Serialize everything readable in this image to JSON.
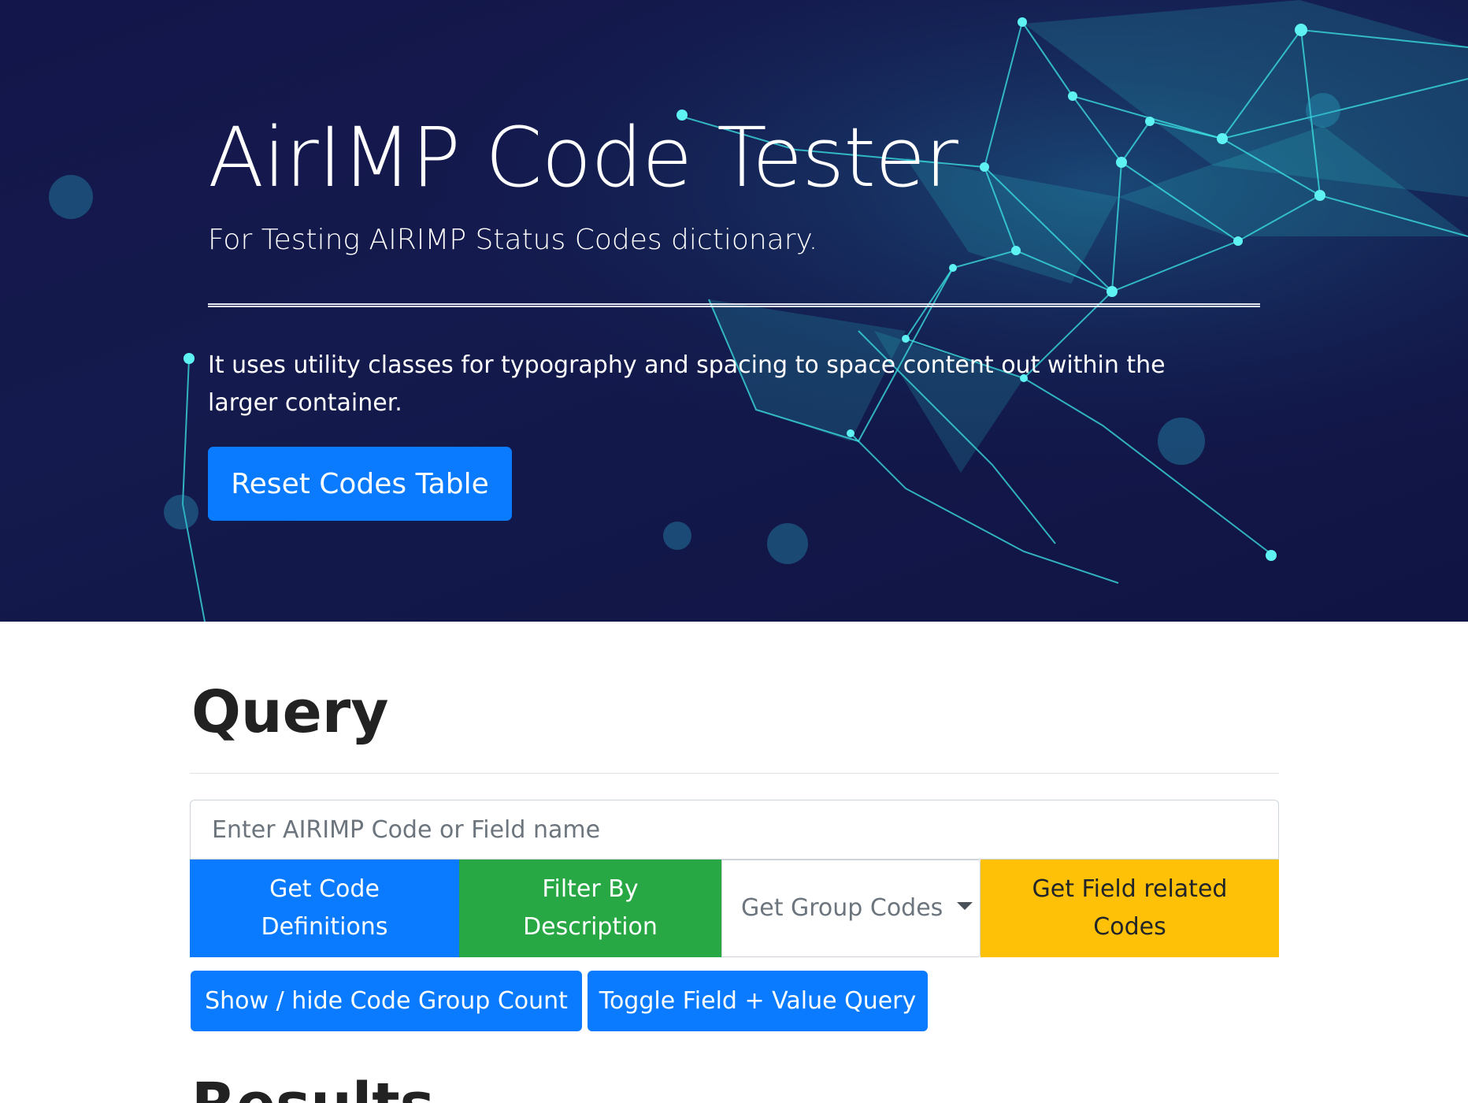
{
  "hero": {
    "title": "AirIMP Code Tester",
    "lead": "For Testing AIRIMP Status Codes dictionary.",
    "text": "It uses utility classes for typography and spacing to space content out within the larger container.",
    "reset_button": "Reset Codes Table"
  },
  "query": {
    "title": "Query",
    "input_placeholder": "Enter AIRIMP Code or Field name",
    "get_code_definitions": "Get Code Definitions",
    "filter_by_description": "Filter By Description",
    "get_group_codes": "Get Group Codes",
    "get_field_related_codes": "Get Field related Codes",
    "show_hide_count": "Show / hide Code Group Count",
    "toggle_field_value": "Toggle Field + Value Query"
  },
  "results": {
    "title": "Results"
  },
  "colors": {
    "hero_bg": "#13164a",
    "primary": "#0a7bff",
    "success": "#28a745",
    "warning": "#ffc107",
    "network": "#2fe0e0"
  }
}
